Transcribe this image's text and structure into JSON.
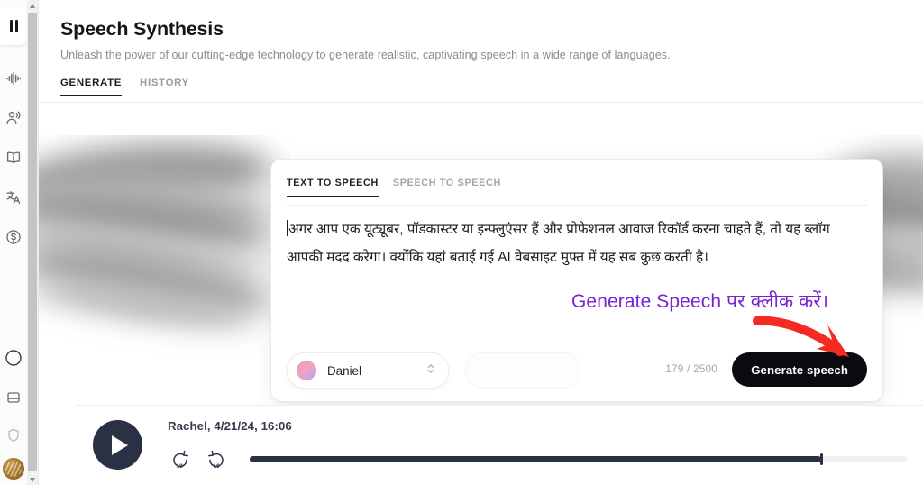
{
  "rail": {
    "logo_icon": "pause-logo-icon",
    "items": [
      {
        "icon": "waveform-icon",
        "name": "speech-synthesis"
      },
      {
        "icon": "voices-people-icon",
        "name": "voices"
      },
      {
        "icon": "book-icon",
        "name": "voice-library"
      },
      {
        "icon": "translate-icon",
        "name": "dubbing"
      },
      {
        "icon": "dollar-circle-icon",
        "name": "subscription"
      },
      {
        "icon": "circle-icon",
        "name": "projects"
      },
      {
        "icon": "card-icon",
        "name": "audio-native"
      },
      {
        "icon": "shield-icon",
        "name": "voice-captcha"
      }
    ],
    "avatar_name": "user-avatar"
  },
  "header": {
    "title": "Speech Synthesis",
    "subtitle": "Unleash the power of our cutting-edge technology to generate realistic, captivating speech in a wide range of languages.",
    "tabs": [
      {
        "label": "GENERATE",
        "active": true
      },
      {
        "label": "HISTORY",
        "active": false
      }
    ]
  },
  "card": {
    "tabs": [
      {
        "label": "TEXT TO SPEECH",
        "active": true
      },
      {
        "label": "SPEECH TO SPEECH",
        "active": false
      }
    ],
    "editor_text": "अगर आप एक यूट्यूबर, पॉडकास्टर या इन्फ्लुएंसर हैं और प्रोफेशनल आवाज रिकॉर्ड करना चाहते हैं, तो यह ब्लॉग आपकी मदद करेगा। क्योंकि यहां बताई गई AI वेबसाइट मुफ्त में यह सब कुछ करती है।",
    "voice_name": "Daniel",
    "voice_chevron_icon": "chevron-up-down-icon",
    "char_count": "179 / 2500",
    "generate_label": "Generate speech"
  },
  "annotation": {
    "text": "Generate Speech पर क्लीक करें।",
    "color": "#7a22d4",
    "arrow_color": "#f52b22",
    "arrow_icon": "curved-arrow-icon"
  },
  "player": {
    "play_icon": "play-icon",
    "track_title": "Rachel, 4/21/24, 16:06",
    "skip_back_label": "10",
    "skip_back_icon": "skip-back-10-icon",
    "skip_forward_label": "10",
    "skip_forward_icon": "skip-forward-10-icon",
    "progress_percent": 87
  },
  "scrollbar": {
    "up_icon": "scroll-up-arrow-icon",
    "down_icon": "scroll-down-arrow-icon"
  },
  "colors": {
    "accent_dark": "#0b0b0f",
    "player_dark": "#2b3145",
    "annotation_purple": "#7a22d4",
    "arrow_red": "#f52b22"
  }
}
